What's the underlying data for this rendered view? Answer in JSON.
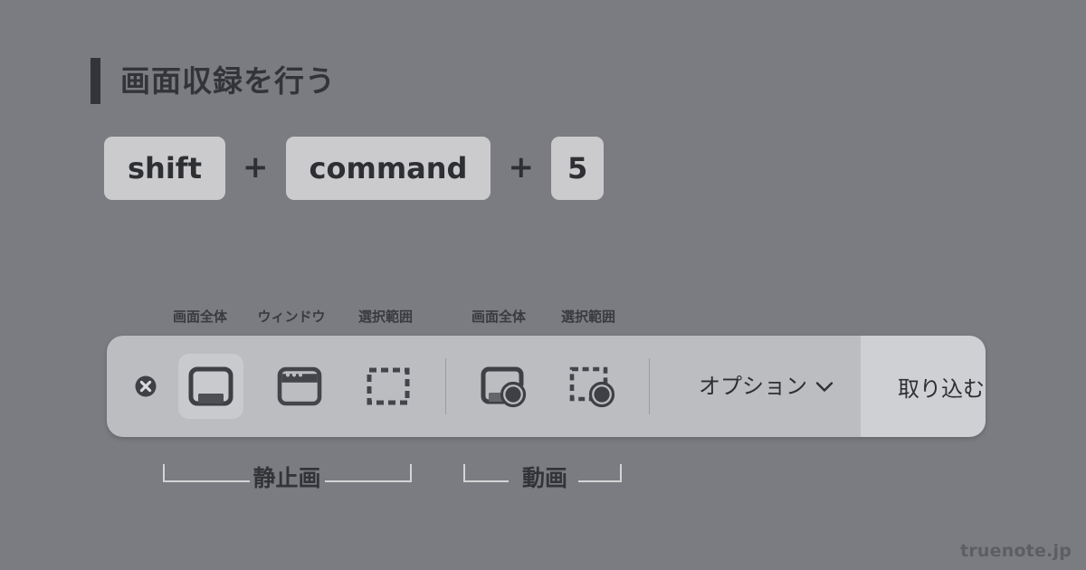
{
  "page": {
    "background_color": "#7b7c81",
    "title": "画面収録を行う",
    "accent_color": "#333438",
    "watermark": "truenote.jp"
  },
  "shortcut": {
    "keys": [
      "shift",
      "command",
      "5"
    ],
    "separator": "+",
    "key_background": "#cbcbcd",
    "key_text_color": "#2e2f33"
  },
  "toolbar": {
    "background_color": "#bcbdc1",
    "selected_background_color": "#c9cacd",
    "icon_color": "#44454a",
    "close": {
      "name": "close-icon",
      "label": "閉じる"
    },
    "tools": [
      {
        "id": "capture-entire-screen",
        "label": "画面全体",
        "group": "still",
        "icon": "screen-icon",
        "selected": true
      },
      {
        "id": "capture-window",
        "label": "ウィンドウ",
        "group": "still",
        "icon": "window-icon",
        "selected": false
      },
      {
        "id": "capture-selection",
        "label": "選択範囲",
        "group": "still",
        "icon": "selection-icon",
        "selected": false
      },
      {
        "id": "record-entire-screen",
        "label": "画面全体",
        "group": "video",
        "icon": "screen-record-icon",
        "selected": false
      },
      {
        "id": "record-selection",
        "label": "選択範囲",
        "group": "video",
        "icon": "selection-record-icon",
        "selected": false
      }
    ],
    "options": {
      "label": "オプション",
      "chevron": "chevron-down-icon"
    },
    "capture": {
      "label": "取り込む",
      "background_color": "#cfd0d3"
    }
  },
  "groups": [
    {
      "id": "still",
      "label": "静止画"
    },
    {
      "id": "video",
      "label": "動画"
    }
  ]
}
